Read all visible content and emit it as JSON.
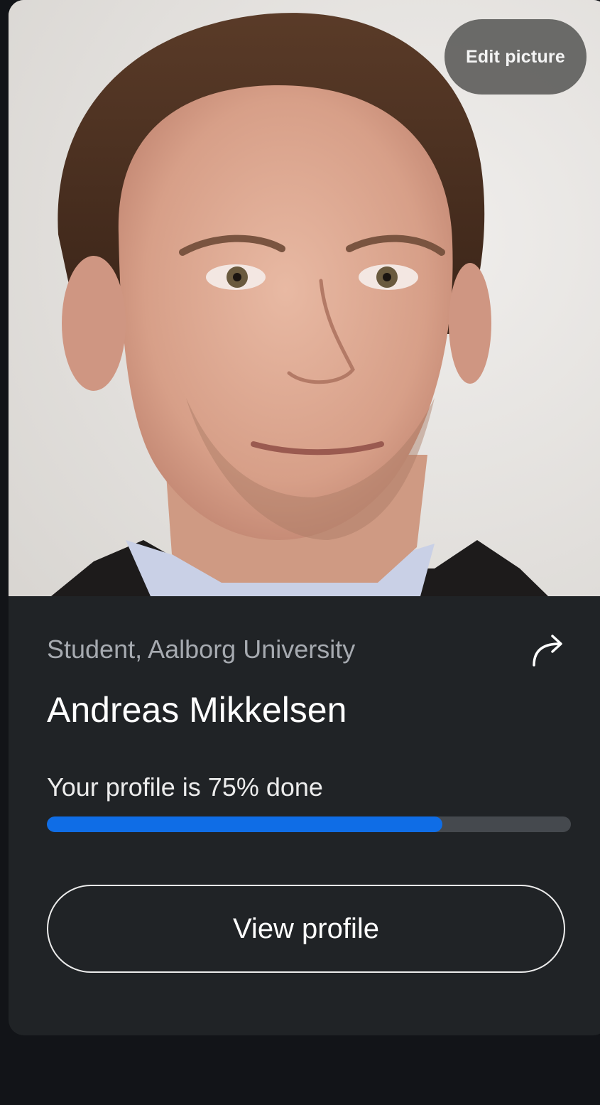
{
  "profile": {
    "edit_picture_label": "Edit picture",
    "role": "Student, Aalborg University",
    "name": "Andreas Mikkelsen",
    "progress_text": "Your profile is 75% done",
    "progress_fraction": 0.755,
    "view_profile_label": "View profile"
  },
  "icons": {
    "share": "share-arrow-icon"
  },
  "colors": {
    "page_background": "#121418",
    "card_background": "#202326",
    "progress_fill": "#0f6de6",
    "progress_track": "#45494e"
  }
}
